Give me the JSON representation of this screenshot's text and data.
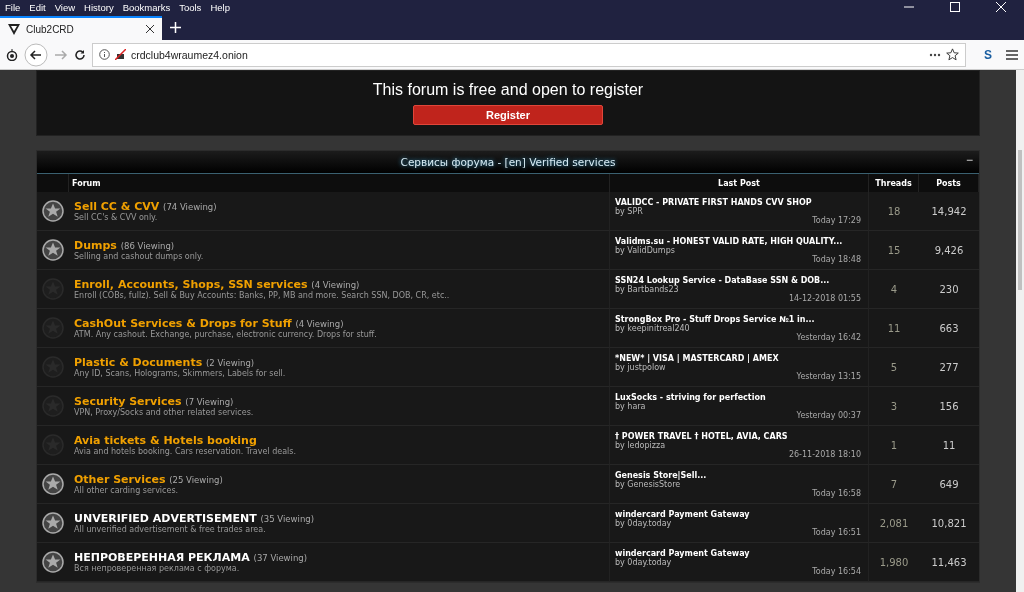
{
  "menu": [
    "File",
    "Edit",
    "View",
    "History",
    "Bookmarks",
    "Tools",
    "Help"
  ],
  "tab": {
    "title": "Club2CRD",
    "selected": true
  },
  "address": {
    "url": "crdclub4wraumez4.onion"
  },
  "toolbar": {
    "extension": "S"
  },
  "notice": {
    "text": "This forum is free and open to register",
    "button": "Register"
  },
  "section": {
    "title": "Сервисы форума - [en] Verified services",
    "collapse": "−",
    "columns": [
      "Forum",
      "Last Post",
      "Threads",
      "Posts"
    ],
    "forums": [
      {
        "title": "Sell CC & CVV",
        "viewing": "(74 Viewing)",
        "description": "Sell CC's & CVV only.",
        "unread": true,
        "color": "#f0a000",
        "last_title": "VALIDCC - PRIVATE FIRST HANDS CVV SHOP",
        "last_by": "by SPR",
        "last_time": "Today 17:29",
        "threads": "18",
        "posts": "14,942"
      },
      {
        "title": "Dumps",
        "viewing": "(86 Viewing)",
        "description": "Selling and cashout dumps only.",
        "unread": true,
        "color": "#f0a000",
        "last_title": "Validms.su - HONEST VALID RATE, HIGH QUALITY...",
        "last_by": "by ValidDumps",
        "last_time": "Today 18:48",
        "threads": "15",
        "posts": "9,426"
      },
      {
        "title": "Enroll, Accounts, Shops, SSN services",
        "viewing": "(4 Viewing)",
        "description": "Enroll (COBs, fullz). Sell & Buy Accounts: Banks, PP, MB and more. Search SSN, DOB, CR, etc..",
        "unread": false,
        "color": "#f0a000",
        "last_title": "SSN24 Lookup Service - DataBase SSN & DOB...",
        "last_by": "by Bartbands23",
        "last_time": "14-12-2018 01:55",
        "threads": "4",
        "posts": "230"
      },
      {
        "title": "CashOut Services & Drops for Stuff",
        "viewing": "(4 Viewing)",
        "description": "ATM. Any cashout. Exchange, purchase, electronic currency. Drops for stuff.",
        "unread": false,
        "color": "#f0a000",
        "last_title": "StrongBox Pro - Stuff Drops Service №1 in...",
        "last_by": "by keepinitreal240",
        "last_time": "Yesterday 16:42",
        "threads": "11",
        "posts": "663"
      },
      {
        "title": "Plastic & Documents",
        "viewing": "(2 Viewing)",
        "description": "Any ID, Scans, Holograms, Skimmers, Labels for sell.",
        "unread": false,
        "color": "#f0a000",
        "last_title": "*NEW* | VISA | MASTERCARD | AMEX",
        "last_by": "by justpolow",
        "last_time": "Yesterday 13:15",
        "threads": "5",
        "posts": "277"
      },
      {
        "title": "Security Services",
        "viewing": "(7 Viewing)",
        "description": "VPN, Proxy/Socks and other related services.",
        "unread": false,
        "color": "#f0a000",
        "last_title": "LuxSocks - striving for perfection",
        "last_by": "by hara",
        "last_time": "Yesterday 00:37",
        "threads": "3",
        "posts": "156"
      },
      {
        "title": "Avia tickets & Hotels booking",
        "description": "Avia and hotels booking. Cars reservation. Travel deals.",
        "unread": false,
        "color": "#f0a000",
        "last_title": "† POWER TRAVEL † HOTEL, AVIA, CARS",
        "last_by": "by ledopizza",
        "last_time": "26-11-2018 18:10",
        "threads": "1",
        "posts": "11"
      },
      {
        "title": "Other Services",
        "viewing": "(25 Viewing)",
        "description": "All other carding services.",
        "unread": true,
        "color": "#f0a000",
        "last_title": "Genesis Store|Sell...",
        "last_by": "by GenesisStore",
        "last_time": "Today 16:58",
        "threads": "7",
        "posts": "649"
      },
      {
        "title": "UNVERIFIED ADVERTISEMENT",
        "viewing": "(35 Viewing)",
        "description": "All unverified advertisement & free trades area.",
        "unread": true,
        "color": "#ffffff",
        "last_title": "windercard Payment Gateway",
        "last_by": "by 0day.today",
        "last_time": "Today 16:51",
        "threads": "2,081",
        "posts": "10,821"
      },
      {
        "title": "НЕПРОВЕРЕННАЯ РЕКЛАМА",
        "viewing": "(37 Viewing)",
        "description": "Вся непроверенная реклама с форума.",
        "unread": true,
        "color": "#ffffff",
        "last_title": "windercard Payment Gateway",
        "last_by": "by 0day.today",
        "last_time": "Today 16:54",
        "threads": "1,980",
        "posts": "11,463"
      }
    ]
  }
}
